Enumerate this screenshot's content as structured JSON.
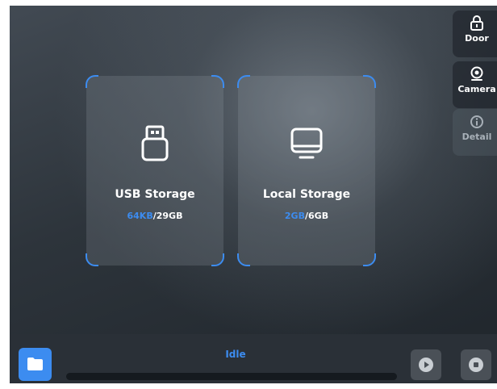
{
  "cards": [
    {
      "title": "USB Storage",
      "used": "64KB",
      "sep": "/",
      "total": "29GB",
      "icon": "usb-drive-icon"
    },
    {
      "title": "Local Storage",
      "used": "2GB",
      "sep": "/",
      "total": "6GB",
      "icon": "monitor-icon"
    }
  ],
  "side_panel": {
    "door_label": "Door",
    "camera_label": "Camera",
    "detail_label": "Detail",
    "door_icon": "lock-icon",
    "camera_icon": "camera-icon",
    "detail_icon": "info-icon"
  },
  "bottom_bar": {
    "status": "Idle",
    "progress": 0,
    "folder_icon": "folder-icon",
    "play_icon": "play-icon",
    "stop_icon": "stop-icon"
  },
  "colors": {
    "accent": "#3c8cf0",
    "background": "#2d343b",
    "card": "#5b646d",
    "bar": "#2a3037"
  }
}
